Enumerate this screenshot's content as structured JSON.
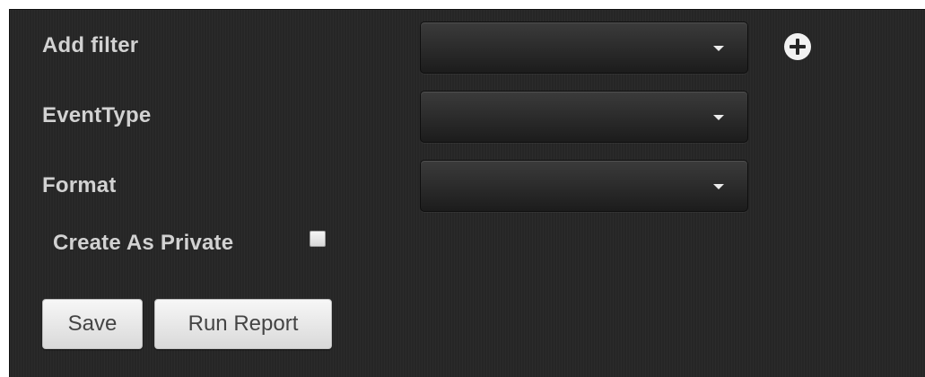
{
  "form": {
    "filter_label": "Add filter",
    "filter_value": "",
    "event_type_label": "EventType",
    "event_type_value": "",
    "format_label": "Format",
    "format_value": "",
    "private_label": "Create As Private",
    "private_checked": false,
    "save_label": "Save",
    "run_report_label": "Run Report"
  },
  "icons": {
    "add_filter": "plus-circle-icon",
    "dropdown": "caret-down-icon"
  },
  "colors": {
    "panel_background": "#262626",
    "label_text": "#d2d2d2",
    "select_background": "#2b2b2b",
    "button_background": "#e8e8e8"
  }
}
